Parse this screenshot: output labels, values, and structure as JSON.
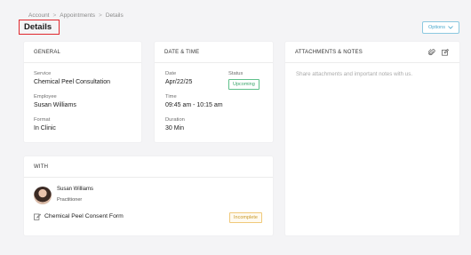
{
  "breadcrumb": {
    "items": [
      "Account",
      "Appointments",
      "Details"
    ],
    "separator": ">"
  },
  "page": {
    "title": "Details"
  },
  "options_button": {
    "label": "Options"
  },
  "general": {
    "header": "GENERAL",
    "service_label": "Service",
    "service_value": "Chemical Peel Consultation",
    "employee_label": "Employee",
    "employee_value": "Susan Williams",
    "format_label": "Format",
    "format_value": "In Clinic"
  },
  "datetime": {
    "header": "DATE & TIME",
    "date_label": "Date",
    "date_value": "Apr/22/25",
    "status_label": "Status",
    "status_value": "Upcoming",
    "time_label": "Time",
    "time_value": "09:45 am - 10:15 am",
    "duration_label": "Duration",
    "duration_value": "30 Min"
  },
  "attachments": {
    "header": "ATTACHMENTS & NOTES",
    "placeholder": "Share attachments and important notes with us."
  },
  "with": {
    "header": "WITH",
    "person_name": "Susan Williams",
    "person_role": "Practitioner",
    "form_name": "Chemical Peel Consent Form",
    "form_status": "Incomplete"
  },
  "colors": {
    "title_highlight": "#e0282e",
    "accent": "#4aa8cc",
    "status_upcoming": "#3aa56b",
    "status_incomplete": "#c99a2a"
  },
  "icons": {
    "attach": "paperclip-icon",
    "note": "edit-note-icon",
    "options": "chevron-down-icon",
    "form": "form-document-icon"
  }
}
